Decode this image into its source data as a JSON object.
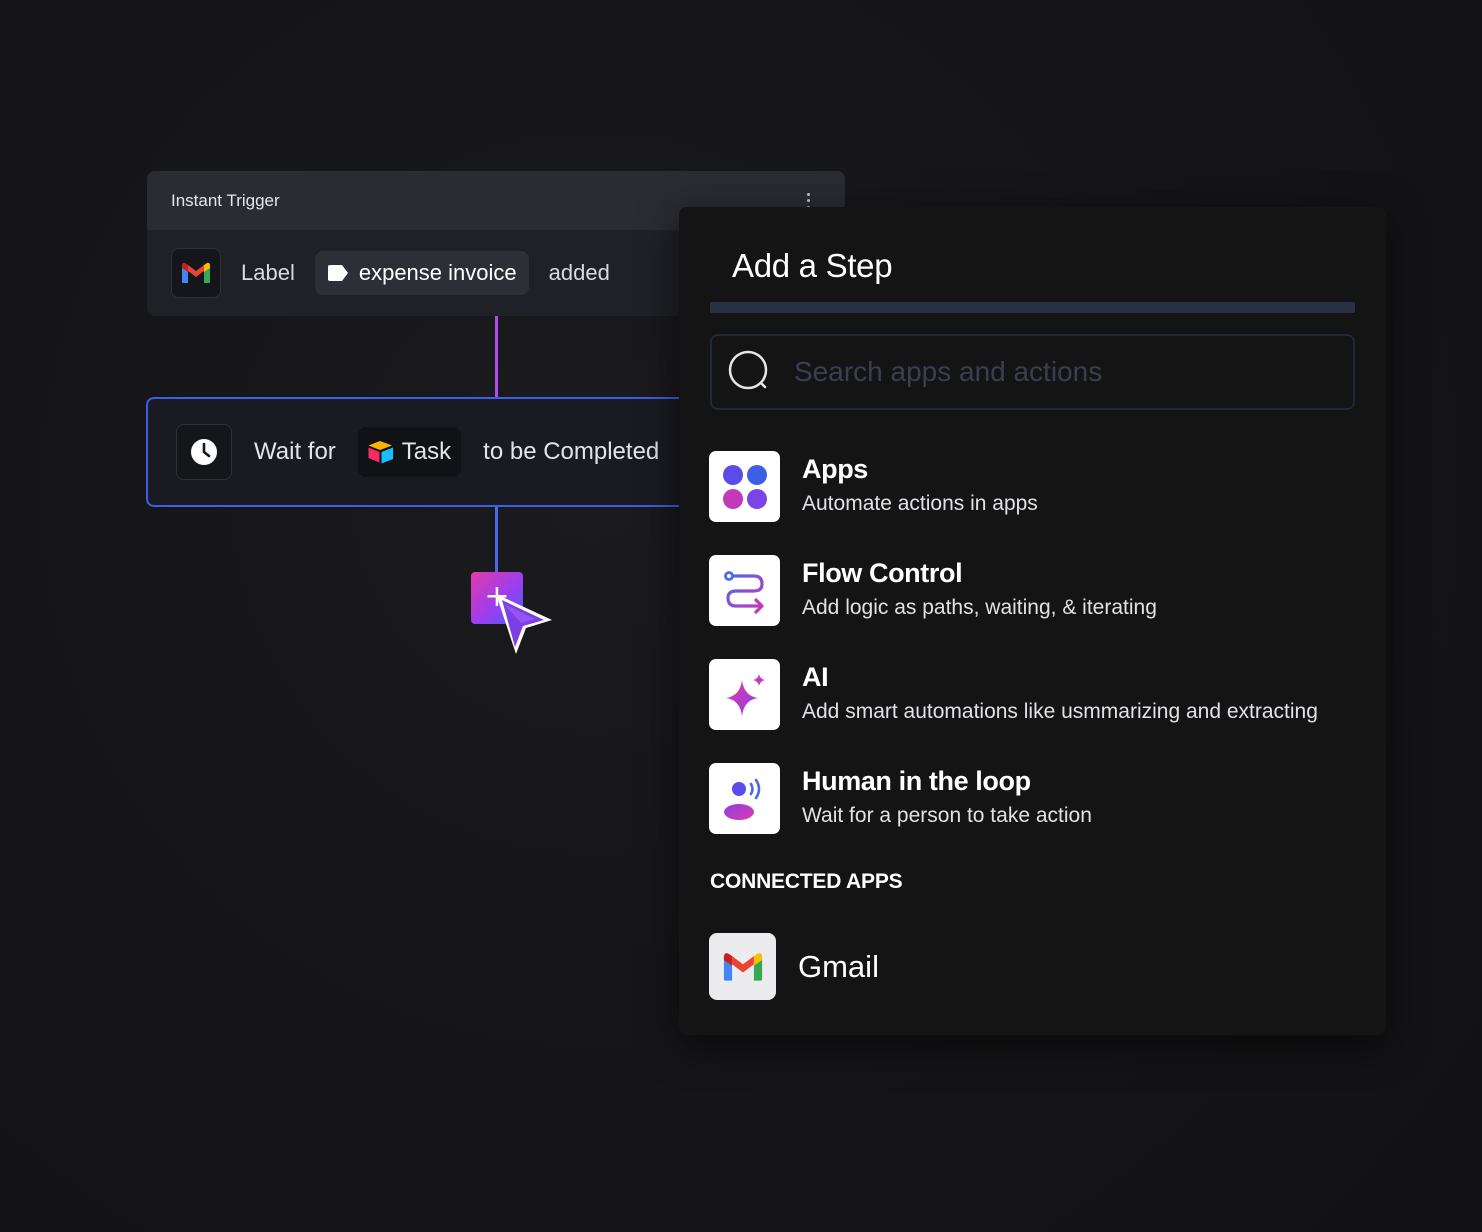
{
  "trigger": {
    "header_title": "Instant Trigger",
    "app_icon": "gmail-icon",
    "label_word": "Label",
    "label_chip": "expense invoice",
    "label_icon": "tag-icon",
    "suffix": "added"
  },
  "wait_step": {
    "icon": "clock-icon",
    "prefix": "Wait for",
    "task_chip": "Task",
    "task_icon": "airtable-icon",
    "suffix": "to be Completed"
  },
  "add_button": {
    "symbol": "+"
  },
  "panel": {
    "title": "Add a Step",
    "search": {
      "placeholder": "Search apps and actions",
      "value": ""
    },
    "items": [
      {
        "title": "Apps",
        "description": "Automate actions in apps",
        "icon": "apps-grid-icon"
      },
      {
        "title": "Flow Control",
        "description": "Add logic as paths, waiting, & iterating",
        "icon": "flow-control-icon"
      },
      {
        "title": "AI",
        "description": "Add smart automations like usmmarizing and extracting",
        "icon": "ai-sparkle-icon"
      },
      {
        "title": "Human in the loop",
        "description": "Wait for a person to take action",
        "icon": "human-loop-icon"
      }
    ],
    "connected_heading": "CONNECTED APPS",
    "connected_apps": [
      {
        "name": "Gmail",
        "icon": "gmail-icon"
      }
    ]
  },
  "colors": {
    "accent_blue": "#3d5ee6",
    "accent_purple": "#b24bf0",
    "accent_pink": "#e23aa6",
    "panel_bg": "#141415"
  }
}
